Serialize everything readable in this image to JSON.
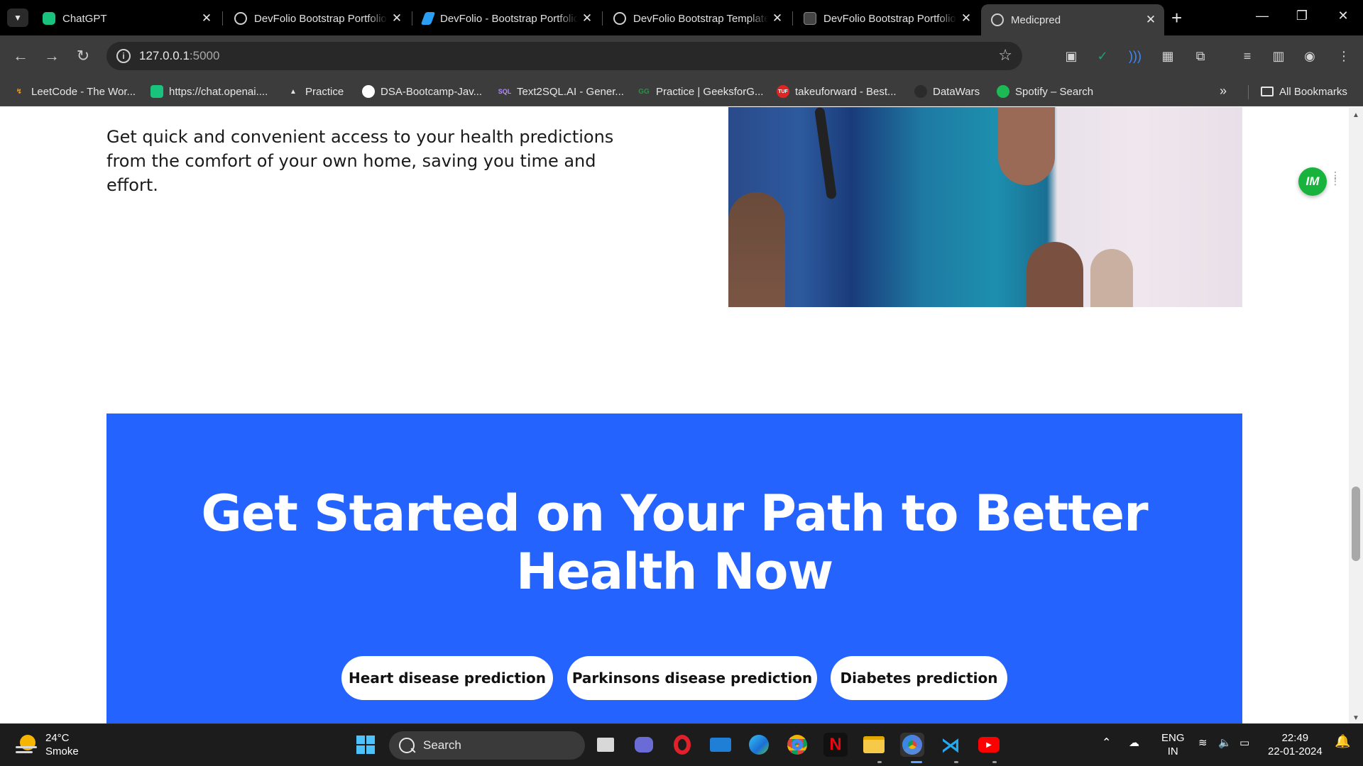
{
  "browser": {
    "tabs": [
      {
        "title": "ChatGPT",
        "favicon_color": "#19c37d"
      },
      {
        "title": "DevFolio Bootstrap Portfolio",
        "favicon_color": "#d0d0d0"
      },
      {
        "title": "DevFolio - Bootstrap Portfolio",
        "favicon_color": "#2a9df4"
      },
      {
        "title": "DevFolio Bootstrap Template",
        "favicon_color": "#d0d0d0"
      },
      {
        "title": "DevFolio Bootstrap Portfolio",
        "favicon_color": "#888888"
      },
      {
        "title": "Medicpred",
        "favicon_color": "#d0d0d0",
        "active": true
      }
    ],
    "close_glyph": "✕",
    "new_tab_glyph": "+",
    "url_host": "127.0.0.1",
    "url_port": ":5000",
    "bookmarks": [
      {
        "label": "LeetCode - The Wor...",
        "icon": "leetcode-icon",
        "color": "#f89f1b"
      },
      {
        "label": "https://chat.openai....",
        "icon": "chatgpt-icon",
        "color": "#19c37d"
      },
      {
        "label": "Practice",
        "icon": "rocket-icon",
        "color": "#e6e6e6"
      },
      {
        "label": "DSA-Bootcamp-Jav...",
        "icon": "github-icon",
        "color": "#ffffff"
      },
      {
        "label": "Text2SQL.AI - Gener...",
        "icon": "text2sql-icon",
        "color": "#8a4dff"
      },
      {
        "label": "Practice | GeeksforG...",
        "icon": "geeksforgeeks-icon",
        "color": "#2f8d46"
      },
      {
        "label": "takeuforward - Best...",
        "icon": "tuf-icon",
        "color": "#e02424"
      },
      {
        "label": "DataWars",
        "icon": "datawars-icon",
        "color": "#3c3c3c"
      },
      {
        "label": "Spotify – Search",
        "icon": "spotify-icon",
        "color": "#1db954"
      }
    ],
    "all_bookmarks_label": "All Bookmarks"
  },
  "page": {
    "feature_text": "Get quick and convenient access to your health predictions from the comfort of your own home, saving you time and effort.",
    "cta_title": "Get Started on Your Path to Better Health Now",
    "cta_buttons": [
      {
        "label": "Heart disease prediction"
      },
      {
        "label": "Parkinsons disease prediction"
      },
      {
        "label": "Diabetes prediction"
      }
    ],
    "cta_color": "#2563ff",
    "floating_widget_label": "IM",
    "floating_widget_color": "#17b33c"
  },
  "taskbar": {
    "weather_temp": "24°C",
    "weather_desc": "Smoke",
    "search_label": "Search",
    "lang_top": "ENG",
    "lang_bottom": "IN",
    "time": "22:49",
    "date": "22-01-2024"
  }
}
